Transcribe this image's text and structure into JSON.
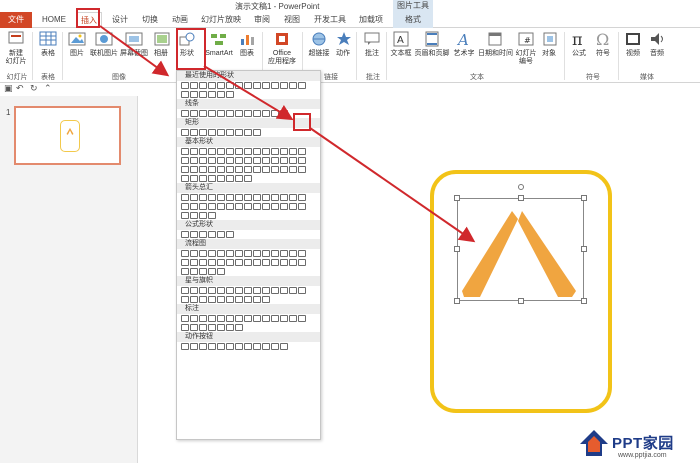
{
  "window": {
    "title": "演示文稿1 - PowerPoint",
    "context_title": "图片工具"
  },
  "tabs": [
    {
      "label": "文件"
    },
    {
      "label": "HOME"
    },
    {
      "label": "插入"
    },
    {
      "label": "设计"
    },
    {
      "label": "切换"
    },
    {
      "label": "动画"
    },
    {
      "label": "幻灯片放映"
    },
    {
      "label": "审阅"
    },
    {
      "label": "视图"
    },
    {
      "label": "开发工具"
    },
    {
      "label": "加载项"
    },
    {
      "label": "格式"
    }
  ],
  "ribbon": {
    "new_slide": "新建\n幻灯片",
    "table": "表格",
    "picture": "图片",
    "online_picture": "联机图片",
    "screenshot": "屏幕截图",
    "album": "相册",
    "shapes": "形状",
    "smartart": "SmartArt",
    "chart": "图表",
    "office_apps": "Office\n应用程序",
    "hyperlink": "超链接",
    "action": "动作",
    "comment": "批注",
    "textbox": "文本框",
    "header_footer": "页眉和页脚",
    "wordart": "艺术字",
    "datetime": "日期和时间",
    "slide_number": "幻灯片\n编号",
    "object": "对象",
    "equation": "公式",
    "symbol": "符号",
    "video": "视频",
    "audio": "音频",
    "groups": {
      "slides": "幻灯片",
      "tables": "表格",
      "images": "图像",
      "links": "链接",
      "comments": "批注",
      "text": "文本",
      "symbols": "符号",
      "media": "媒体"
    }
  },
  "shapes_menu": {
    "sections": [
      "最近使用的形状",
      "线条",
      "矩形",
      "基本形状",
      "箭头总汇",
      "公式形状",
      "流程图",
      "星与旗帜",
      "标注",
      "动作按钮"
    ]
  },
  "slide_panel": {
    "slide_number": "1"
  },
  "logo": {
    "brand_latin": "PPT",
    "brand_cn": "家园",
    "url": "www.pptjia.com"
  },
  "colors": {
    "accent_red": "#d0282c",
    "frame_yellow": "#f2c318",
    "shape_orange": "#f0a540",
    "file_tab": "#d24726"
  }
}
